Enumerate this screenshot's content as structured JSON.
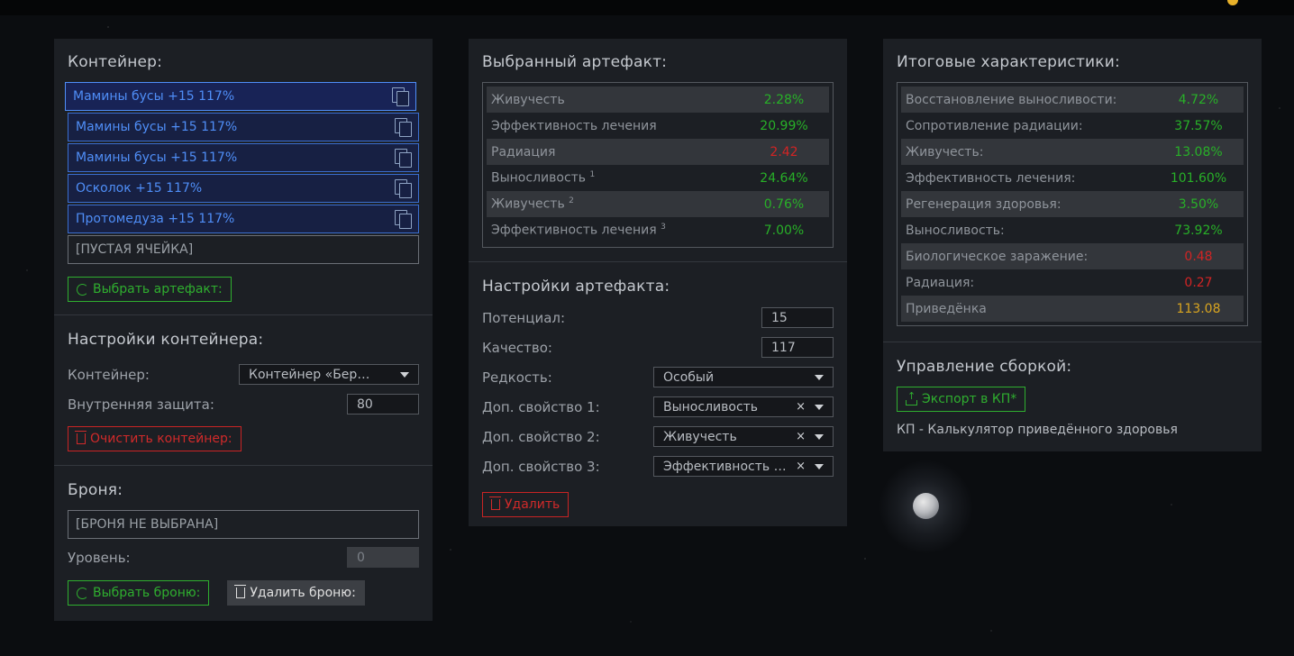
{
  "container_panel": {
    "title": "Контейнер:",
    "slots": [
      {
        "label": "Мамины бусы +15 117%"
      },
      {
        "label": "Мамины бусы +15 117%"
      },
      {
        "label": "Мамины бусы +15 117%"
      },
      {
        "label": "Осколок +15 117%"
      },
      {
        "label": "Протомедуза +15 117%"
      }
    ],
    "empty_slot": "[ПУСТАЯ ЯЧЕЙКА]",
    "select_artifact_button": "Выбрать артефакт:"
  },
  "container_settings": {
    "title": "Настройки контейнера:",
    "container_label": "Контейнер:",
    "container_value": "Контейнер «Берлога...",
    "protection_label": "Внутренняя защита:",
    "protection_value": "80",
    "clear_button": "Очистить контейнер:"
  },
  "armor": {
    "title": "Броня:",
    "armor_value": "[БРОНЯ НЕ ВЫБРАНА]",
    "level_label": "Уровень:",
    "level_value": "0",
    "select_button": "Выбрать броню:",
    "remove_button": "Удалить броню:"
  },
  "selected_artifact": {
    "title": "Выбранный артефакт:",
    "stats": [
      {
        "name": "Живучесть",
        "sup": "",
        "value": "2.28%",
        "color": "#28b028"
      },
      {
        "name": "Эффективность лечения",
        "sup": "",
        "value": "20.99%",
        "color": "#28b028"
      },
      {
        "name": "Радиация",
        "sup": "",
        "value": "2.42",
        "color": "#d22424"
      },
      {
        "name": "Выносливость",
        "sup": "1",
        "value": "24.64%",
        "color": "#28b028"
      },
      {
        "name": "Живучесть",
        "sup": "2",
        "value": "0.76%",
        "color": "#28b028"
      },
      {
        "name": "Эффективность лечения",
        "sup": "3",
        "value": "7.00%",
        "color": "#28b028"
      }
    ]
  },
  "artifact_settings": {
    "title": "Настройки артефакта:",
    "potential_label": "Потенциал:",
    "potential_value": "15",
    "quality_label": "Качество:",
    "quality_value": "117",
    "rarity_label": "Редкость:",
    "rarity_value": "Особый",
    "prop1_label": "Доп. свойство 1:",
    "prop1_value": "Выносливость",
    "prop2_label": "Доп. свойство 2:",
    "prop2_value": "Живучесть",
    "prop3_label": "Доп. свойство 3:",
    "prop3_value": "Эффективность ле...",
    "clear_icon": "×",
    "delete_button": "Удалить"
  },
  "totals": {
    "title": "Итоговые характеристики:",
    "stats": [
      {
        "name": "Восстановление выносливости:",
        "value": "4.72%",
        "color": "#28b028"
      },
      {
        "name": "Сопротивление радиации:",
        "value": "37.57%",
        "color": "#28b028"
      },
      {
        "name": "Живучесть:",
        "value": "13.08%",
        "color": "#28b028"
      },
      {
        "name": "Эффективность лечения:",
        "value": "101.60%",
        "color": "#28b028"
      },
      {
        "name": "Регенерация здоровья:",
        "value": "3.50%",
        "color": "#28b028"
      },
      {
        "name": "Выносливость:",
        "value": "73.92%",
        "color": "#28b028"
      },
      {
        "name": "Биологическое заражение:",
        "value": "0.48",
        "color": "#d22424"
      },
      {
        "name": "Радиация:",
        "value": "0.27",
        "color": "#d22424"
      },
      {
        "name": "Приведёнка",
        "value": "113.08",
        "color": "#d9a520"
      }
    ]
  },
  "build_management": {
    "title": "Управление сборкой:",
    "export_button": "Экспорт в КП*",
    "note": "КП - Калькулятор приведённого здоровья"
  }
}
